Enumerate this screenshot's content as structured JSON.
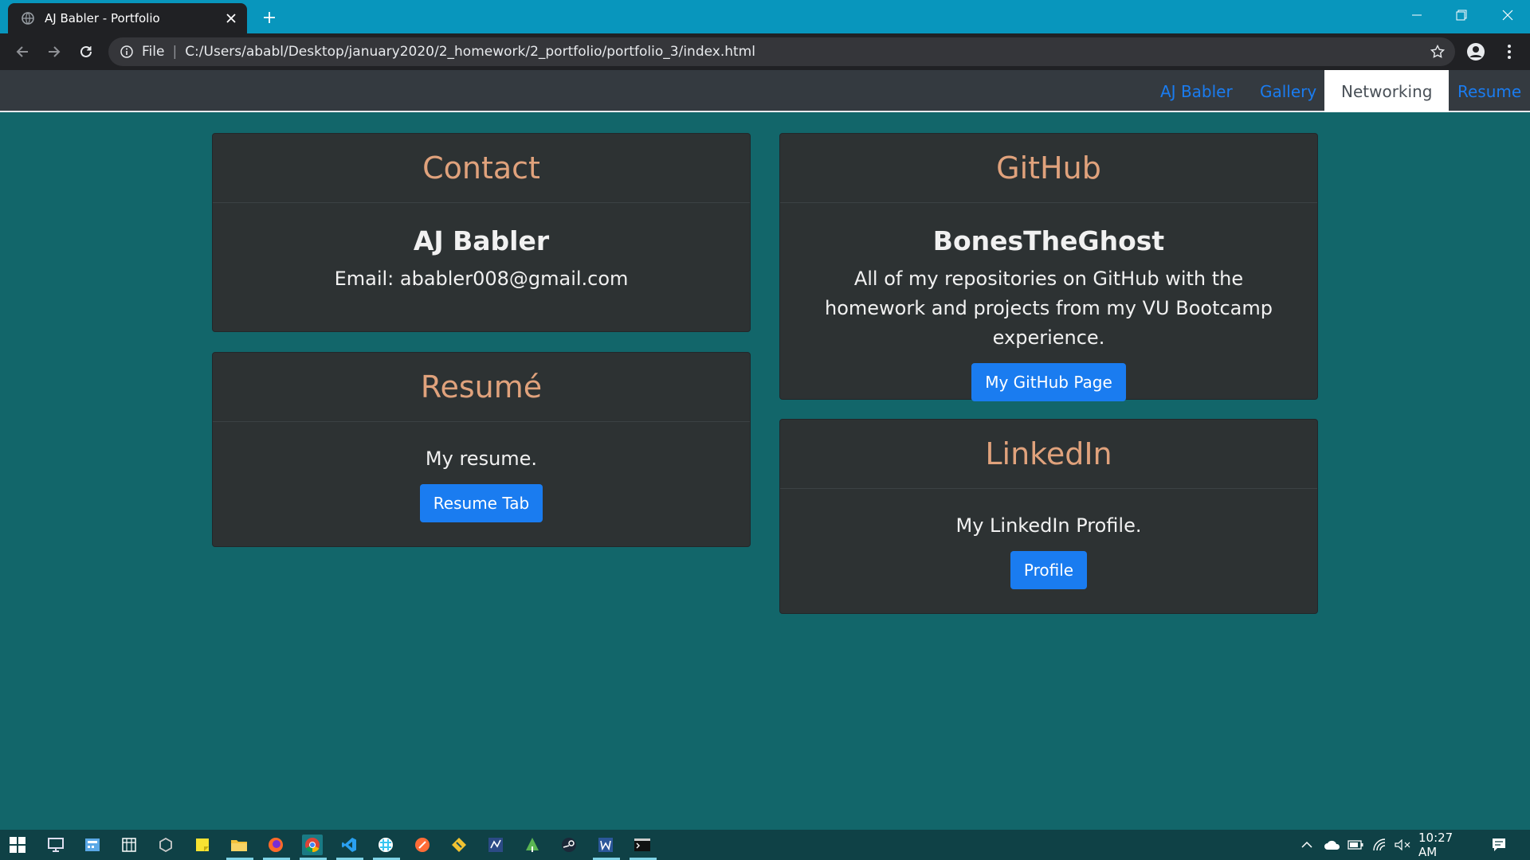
{
  "browser": {
    "tab_title": "AJ Babler - Portfolio",
    "scheme_label": "File",
    "url": "C:/Users/ababl/Desktop/january2020/2_homework/2_portfolio/portfolio_3/index.html"
  },
  "nav": {
    "items": [
      {
        "label": "AJ Babler",
        "active": false
      },
      {
        "label": "Gallery",
        "active": false
      },
      {
        "label": "Networking",
        "active": true
      },
      {
        "label": "Resume",
        "active": false
      }
    ]
  },
  "cards": {
    "contact": {
      "header": "Contact",
      "name": "AJ Babler",
      "text": "Email: ababler008@gmail.com"
    },
    "resume": {
      "header": "Resumé",
      "text": "My resume.",
      "button": "Resume Tab"
    },
    "github": {
      "header": "GitHub",
      "name": "BonesTheGhost",
      "text": "All of my repositories on GitHub with the homework and projects from my VU Bootcamp experience.",
      "button": "My GitHub Page"
    },
    "linkedin": {
      "header": "LinkedIn",
      "text": "My LinkedIn Profile.",
      "button": "Profile"
    }
  },
  "taskbar": {
    "clock": "10:27 AM"
  },
  "colors": {
    "page_bg": "#12666a",
    "card_bg": "#2d3233",
    "card_header_text": "#e0a27c",
    "link_blue": "#1a7cf0",
    "button_blue": "#1a7cf0",
    "navbar_bg": "#343a40",
    "titlebar_bg": "#0896bd"
  }
}
